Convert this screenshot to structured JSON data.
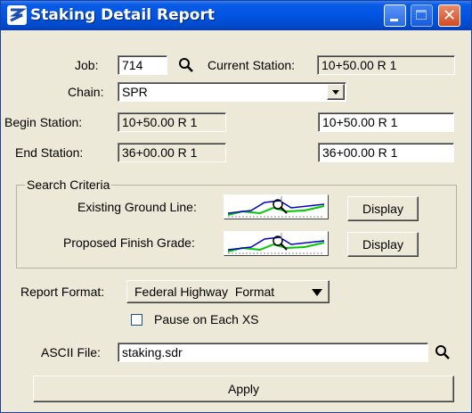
{
  "window": {
    "title": "Staking Detail Report"
  },
  "job": {
    "label": "Job:",
    "value": "714"
  },
  "current_station": {
    "label": "Current Station:",
    "value": "10+50.00 R 1"
  },
  "chain": {
    "label": "Chain:",
    "value": "SPR"
  },
  "begin_station": {
    "label": "Begin Station:",
    "readonly_value": "10+50.00 R 1",
    "value": "10+50.00 R 1"
  },
  "end_station": {
    "label": "End Station:",
    "readonly_value": "36+00.00 R 1",
    "value": "36+00.00 R 1"
  },
  "search_criteria": {
    "title": "Search Criteria",
    "existing_ground": {
      "label": "Existing Ground Line:",
      "button": "Display"
    },
    "proposed_finish": {
      "label": "Proposed Finish Grade:",
      "button": "Display"
    }
  },
  "report_format": {
    "label": "Report Format:",
    "value": "Federal Highway  Format"
  },
  "pause": {
    "label": "Pause on Each XS",
    "checked": false
  },
  "ascii_file": {
    "label": "ASCII File:",
    "value": "staking.sdr"
  },
  "apply": {
    "label": "Apply"
  }
}
